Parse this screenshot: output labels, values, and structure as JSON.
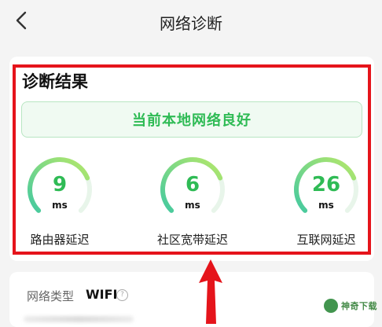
{
  "header": {
    "title": "网络诊断",
    "back_icon": "chevron-left-icon"
  },
  "result": {
    "heading": "诊断结果",
    "status": "当前本地网络良好",
    "status_color": "#2fbb55",
    "highlight_color": "#e5141b",
    "gauges": [
      {
        "value": "9",
        "unit": "ms",
        "label": "路由器延迟",
        "level": 0.75
      },
      {
        "value": "6",
        "unit": "ms",
        "label": "社区宽带延迟",
        "level": 0.75
      },
      {
        "value": "26",
        "unit": "ms",
        "label": "互联网延迟",
        "level": 0.75
      }
    ]
  },
  "network_info": {
    "type_label": "网络类型",
    "type_value": "WIFI",
    "help_icon": "question-circle-icon",
    "help_glyph": "?"
  },
  "annotation": {
    "arrow_icon": "red-arrow-up-icon"
  },
  "watermark": {
    "text": "神奇下载"
  }
}
